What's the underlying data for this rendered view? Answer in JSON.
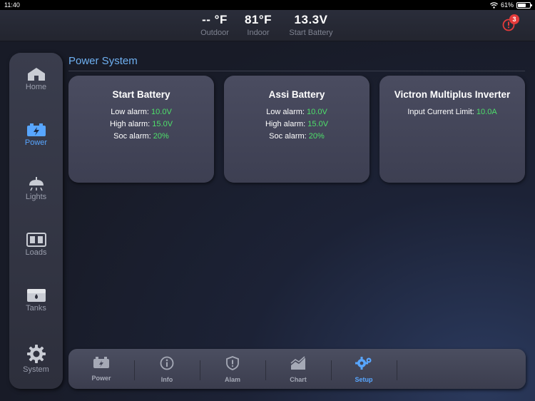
{
  "status_bar": {
    "time": "11:40",
    "battery": "61%"
  },
  "header": {
    "outdoor": {
      "value": "-- °F",
      "label": "Outdoor"
    },
    "indoor": {
      "value": "81°F",
      "label": "Indoor"
    },
    "start_battery": {
      "value": "13.3V",
      "label": "Start Battery"
    },
    "alert_count": "3"
  },
  "sidebar": {
    "items": [
      {
        "label": "Home",
        "icon": "home-icon"
      },
      {
        "label": "Power",
        "icon": "battery-icon",
        "active": true
      },
      {
        "label": "Lights",
        "icon": "lamp-icon"
      },
      {
        "label": "Loads",
        "icon": "switch-panel-icon"
      },
      {
        "label": "Tanks",
        "icon": "tank-icon"
      },
      {
        "label": "System",
        "icon": "gear-icon"
      }
    ]
  },
  "main": {
    "title": "Power System",
    "cards": [
      {
        "title": "Start Battery",
        "rows": [
          {
            "label": "Low alarm:",
            "value": "10.0V"
          },
          {
            "label": "High alarm:",
            "value": "15.0V"
          },
          {
            "label": "Soc alarm:",
            "value": "20%"
          }
        ]
      },
      {
        "title": "Assi Battery",
        "rows": [
          {
            "label": "Low alarm:",
            "value": "10.0V"
          },
          {
            "label": "High alarm:",
            "value": "15.0V"
          },
          {
            "label": "Soc alarm:",
            "value": "20%"
          }
        ]
      },
      {
        "title": "Victron Multiplus Inverter",
        "rows": [
          {
            "label": "Input Current Limit:",
            "value": "10.0A"
          }
        ]
      }
    ]
  },
  "tabbar": {
    "tabs": [
      {
        "label": "Power",
        "icon": "battery-icon"
      },
      {
        "label": "Info",
        "icon": "info-icon"
      },
      {
        "label": "Alam",
        "icon": "alarm-shield-icon"
      },
      {
        "label": "Chart",
        "icon": "chart-icon"
      },
      {
        "label": "Setup",
        "icon": "settings-gears-icon",
        "active": true
      }
    ]
  },
  "colors": {
    "accent": "#58a6ff",
    "value_green": "#4ee06a",
    "alert_red": "#e43b3b"
  }
}
